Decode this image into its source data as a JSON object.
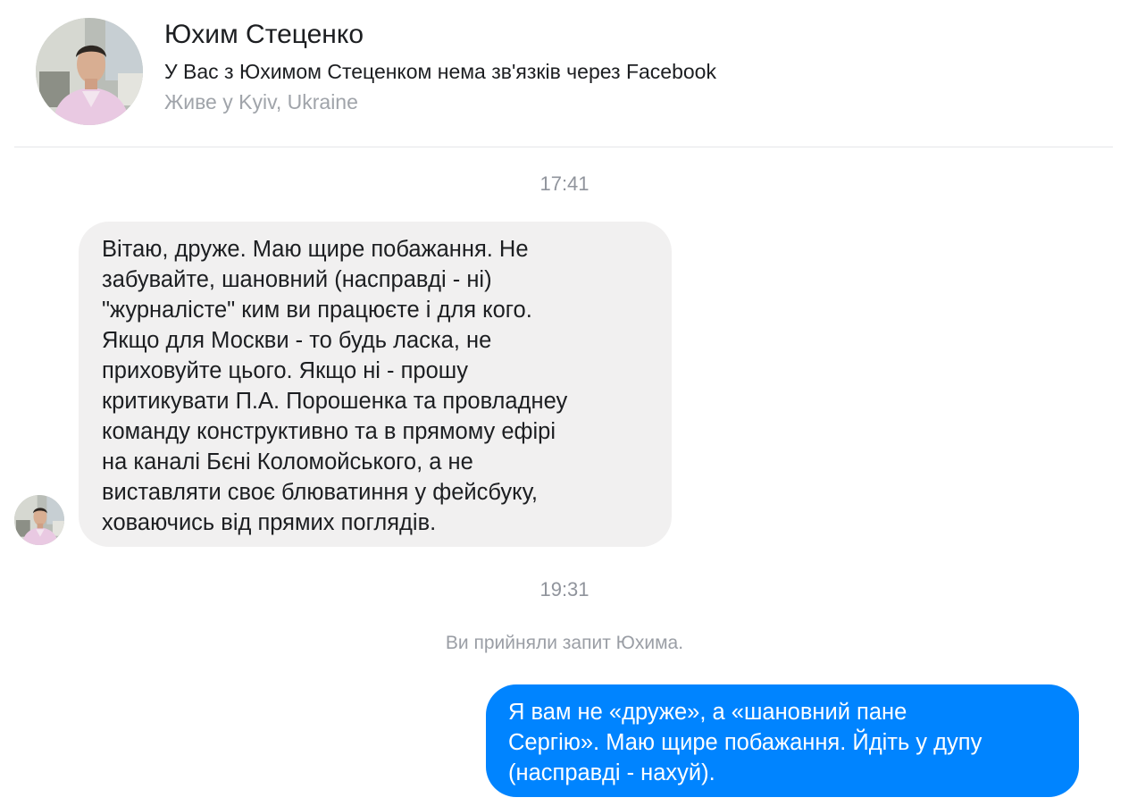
{
  "header": {
    "avatar_icon": "profile-photo-icon",
    "name": "Юхим Стеценко",
    "connection_note": "У Вас з Юхимом Стеценком нема зв'язків через Facebook",
    "location": "Живе у Kyiv, Ukraine"
  },
  "conversation": {
    "timestamps": [
      "17:41",
      "19:31"
    ],
    "system_note": "Ви прийняли запит Юхима.",
    "incoming": {
      "sender_avatar_icon": "profile-photo-icon",
      "lines": [
        "Вітаю, друже. Маю щире побажання. Не",
        "забувайте, шановний (насправді - ні)",
        "\"журналісте\" ким ви працюєте і для кого.",
        "Якщо для Москви - то будь ласка, не",
        "приховуйте цього. Якщо ні - прошу",
        "критикувати П.А. Порошенка та провладнеу",
        "команду конструктивно та в прямому ефірі",
        "на каналі Бєні Коломойського, а не",
        "виставляти своє блюватиння у фейсбуку,",
        "ховаючись від прямих поглядів."
      ]
    },
    "outgoing": {
      "lines": [
        "Я вам не «друже», а «шановний пане",
        "Сергію». Маю щире побажання. Йдіть у дупу",
        "(насправді - нахуй)."
      ]
    }
  },
  "colors": {
    "outgoing_bubble": "#0084ff",
    "incoming_bubble": "#f1f0f0",
    "muted_text": "#90949c"
  }
}
